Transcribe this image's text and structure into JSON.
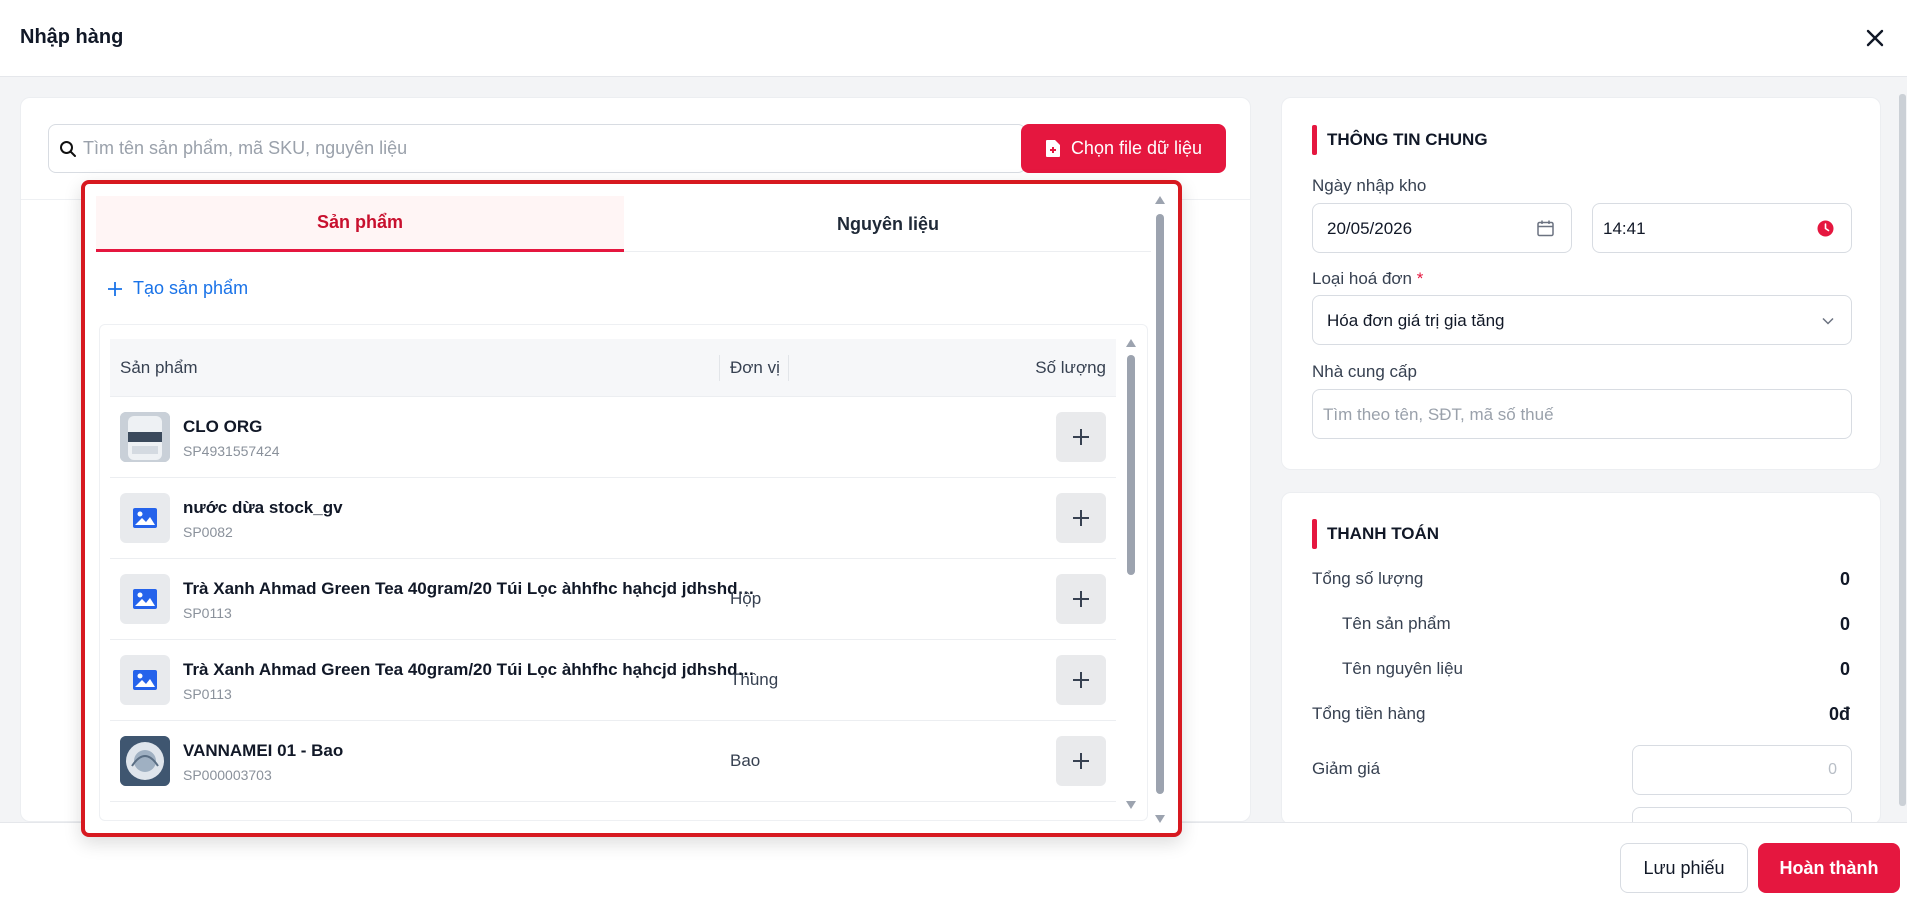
{
  "window": {
    "title": "Nhập hàng"
  },
  "search": {
    "placeholder": "Tìm tên sản phẩm, mã SKU, nguyên liệu",
    "file_button": "Chọn file dữ liệu"
  },
  "dropdown": {
    "tabs": [
      {
        "label": "Sản phẩm",
        "active": true
      },
      {
        "label": "Nguyên liệu",
        "active": false
      }
    ],
    "create_label": "Tạo sản phẩm",
    "columns": {
      "product": "Sản phẩm",
      "unit": "Đơn vị",
      "quantity": "Số lượng"
    },
    "rows": [
      {
        "name": "CLO ORG",
        "sku": "SP4931557424",
        "unit": "",
        "thumb": "product-photo"
      },
      {
        "name": "nước dừa stock_gv",
        "sku": "SP0082",
        "unit": "",
        "thumb": "image-placeholder-icon"
      },
      {
        "name": "Trà Xanh Ahmad Green Tea 40gram/20 Túi Lọc àhhfhc hạhcjd jdhshdhf ...",
        "sku": "SP0113",
        "unit": "Hộp",
        "thumb": "image-placeholder-icon"
      },
      {
        "name": "Trà Xanh Ahmad Green Tea 40gram/20 Túi Lọc àhhfhc hạhcjd jdhshdhf ...",
        "sku": "SP0113",
        "unit": "Thùng",
        "thumb": "image-placeholder-icon"
      },
      {
        "name": "VANNAMEI 01 - Bao",
        "sku": "SP000003703",
        "unit": "Bao",
        "thumb": "product-photo"
      }
    ]
  },
  "general_info": {
    "title": "THÔNG TIN CHUNG",
    "date_label": "Ngày nhập kho",
    "date_value": "20/05/2026",
    "time_value": "14:41",
    "invoice_label": "Loại hoá đơn",
    "invoice_required": "*",
    "invoice_value": "Hóa đơn giá trị gia tăng",
    "supplier_label": "Nhà cung cấp",
    "supplier_placeholder": "Tìm theo tên, SĐT, mã số thuế"
  },
  "payment": {
    "title": "THANH TOÁN",
    "total_qty_label": "Tổng số lượng",
    "total_qty": "0",
    "product_name_label": "Tên sản phẩm",
    "product_count": "0",
    "material_name_label": "Tên nguyên liệu",
    "material_count": "0",
    "total_goods_label": "Tổng tiền hàng",
    "total_goods": "0đ",
    "discount_label": "Giảm giá",
    "discount_value": "0"
  },
  "footer": {
    "save_label": "Lưu phiếu",
    "done_label": "Hoàn thành"
  },
  "colors": {
    "accent": "#e5173f",
    "link": "#1a73e8",
    "highlight_border": "#d71920"
  }
}
